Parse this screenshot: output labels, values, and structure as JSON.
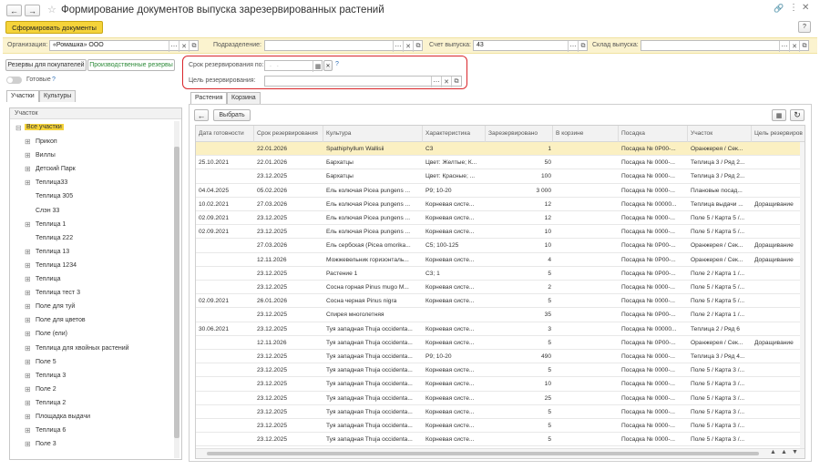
{
  "window": {
    "title": "Формирование документов выпуска зарезервированных растений",
    "help_label": "?"
  },
  "toolbar": {
    "generate_label": "Сформировать документы"
  },
  "filters": {
    "org_label": "Организация:",
    "org_value": "«Ромашка» ООО",
    "dept_label": "Подразделение:",
    "dept_value": "",
    "account_label": "Счет выпуска:",
    "account_value": "43",
    "warehouse_label": "Склад выпуска:",
    "warehouse_value": ""
  },
  "left": {
    "tab_buyers": "Резервы для покупателей",
    "tab_production": "Производственные резервы",
    "ready_label": "Готовые",
    "ready_help": "?",
    "subtab_sections": "Участки",
    "subtab_crops": "Культуры",
    "tree_header": "Участок",
    "tree_root": "Все участки",
    "tree_items": [
      {
        "label": "Прикоп",
        "expandable": true
      },
      {
        "label": "Виллы",
        "expandable": true
      },
      {
        "label": "Детский Парк",
        "expandable": true
      },
      {
        "label": "Теплица33",
        "expandable": true
      },
      {
        "label": "Теплица 305",
        "expandable": false
      },
      {
        "label": "Слэн 33",
        "expandable": false
      },
      {
        "label": "Теплица 1",
        "expandable": true
      },
      {
        "label": "Теплица 222",
        "expandable": false
      },
      {
        "label": "Теплица 13",
        "expandable": true
      },
      {
        "label": "Теплица 1234",
        "expandable": true
      },
      {
        "label": "Теплица",
        "expandable": true
      },
      {
        "label": "Теплица  тест 3",
        "expandable": true
      },
      {
        "label": "Поле для туй",
        "expandable": true
      },
      {
        "label": "Поле для цветов",
        "expandable": true
      },
      {
        "label": "Поле (ели)",
        "expandable": true
      },
      {
        "label": "Теплица для хвойных растений",
        "expandable": true
      },
      {
        "label": "Поле 5",
        "expandable": true
      },
      {
        "label": "Теплица 3",
        "expandable": true
      },
      {
        "label": "Поле 2",
        "expandable": true
      },
      {
        "label": "Теплица 2",
        "expandable": true
      },
      {
        "label": "Площадка выдачи",
        "expandable": true
      },
      {
        "label": "Теплица 6",
        "expandable": true
      },
      {
        "label": "Поле 3",
        "expandable": true
      }
    ]
  },
  "reserve_box": {
    "date_label": "Срок резервирования по:",
    "date_placeholder": ". .",
    "date_help": "?",
    "purpose_label": "Цель резервирования:",
    "purpose_value": ""
  },
  "main": {
    "tab_plants": "Растения",
    "tab_cart": "Корзина",
    "select_label": "Выбрать",
    "columns": [
      "Дата готовности",
      "Срок резервирования",
      "Культура",
      "Характеристика",
      "Зарезервировано",
      "В корзине",
      "Посадка",
      "Участок",
      "Цель резервиров"
    ],
    "rows": [
      [
        "",
        "22.01.2026",
        "Spathiphyllum Wallisii",
        "С3",
        "1",
        "",
        "Посадка № 0Р00-...",
        "Оранжерея / Сек...",
        ""
      ],
      [
        "25.10.2021",
        "22.01.2026",
        "Бархатцы",
        "Цвет: Желтые; К...",
        "50",
        "",
        "Посадка № 0000-...",
        "Теплица 3 / Ряд 2...",
        ""
      ],
      [
        "",
        "23.12.2025",
        "Бархатцы",
        "Цвет: Красные; ...",
        "100",
        "",
        "Посадка № 0000-...",
        "Теплица 3 / Ряд 2...",
        ""
      ],
      [
        "04.04.2025",
        "05.02.2026",
        "Ель колючая Picea pungens ...",
        "Р9; 10-20",
        "3 000",
        "",
        "Посадка № 0000-...",
        "Плановые посад...",
        ""
      ],
      [
        "10.02.2021",
        "27.03.2026",
        "Ель колючая Picea pungens ...",
        "Корневая систе...",
        "12",
        "",
        "Посадка № 00000...",
        "Теплица выдачи ...",
        "Доращивание"
      ],
      [
        "02.09.2021",
        "23.12.2025",
        "Ель колючая Picea pungens ...",
        "Корневая систе...",
        "12",
        "",
        "Посадка № 0000-...",
        "Поле 5 / Карта 5 /...",
        ""
      ],
      [
        "02.09.2021",
        "23.12.2025",
        "Ель колючая Picea pungens ...",
        "Корневая систе...",
        "10",
        "",
        "Посадка № 0000-...",
        "Поле 5 / Карта 5 /...",
        ""
      ],
      [
        "",
        "27.03.2026",
        "Ель сербская (Picea omorika...",
        "С5; 100-125",
        "10",
        "",
        "Посадка № 0Р00-...",
        "Оранжерея / Сек...",
        "Доращивание"
      ],
      [
        "",
        "12.11.2026",
        "Можжевельник горизонталь...",
        "Корневая систе...",
        "4",
        "",
        "Посадка № 0Р00-...",
        "Оранжерея / Сек...",
        "Доращивание"
      ],
      [
        "",
        "23.12.2025",
        "Растение 1",
        "С3; 1",
        "5",
        "",
        "Посадка № 0Р00-...",
        "Поле 2 / Карта 1 /...",
        ""
      ],
      [
        "",
        "23.12.2025",
        "Сосна горная Pinus mugo M...",
        "Корневая систе...",
        "2",
        "",
        "Посадка № 0000-...",
        "Поле 5 / Карта 5 /...",
        ""
      ],
      [
        "02.09.2021",
        "26.01.2026",
        "Сосна черная Pinus nigra",
        "Корневая систе...",
        "5",
        "",
        "Посадка № 0000-...",
        "Поле 5 / Карта 5 /...",
        ""
      ],
      [
        "",
        "23.12.2025",
        "Спирея многолетняя",
        "",
        "35",
        "",
        "Посадка № 0Р00-...",
        "Поле 2 / Карта 1 /...",
        ""
      ],
      [
        "30.06.2021",
        "23.12.2025",
        "Туя западная Thuja occidenta...",
        "Корневая систе...",
        "3",
        "",
        "Посадка № 00000...",
        "Теплица 2 / Ряд 6",
        ""
      ],
      [
        "",
        "12.11.2026",
        "Туя западная Thuja occidenta...",
        "Корневая систе...",
        "5",
        "",
        "Посадка № 0Р00-...",
        "Оранжерея / Сек...",
        "Доращивание"
      ],
      [
        "",
        "23.12.2025",
        "Туя западная Thuja occidenta...",
        "Р9; 10-20",
        "490",
        "",
        "Посадка № 0000-...",
        "Теплица 3 / Ряд 4...",
        ""
      ],
      [
        "",
        "23.12.2025",
        "Туя западная Thuja occidenta...",
        "Корневая систе...",
        "5",
        "",
        "Посадка № 0000-...",
        "Поле 5 / Карта 3 /...",
        ""
      ],
      [
        "",
        "23.12.2025",
        "Туя западная Thuja occidenta...",
        "Корневая систе...",
        "10",
        "",
        "Посадка № 0000-...",
        "Поле 5 / Карта 3 /...",
        ""
      ],
      [
        "",
        "23.12.2025",
        "Туя западная Thuja occidenta...",
        "Корневая систе...",
        "25",
        "",
        "Посадка № 0000-...",
        "Поле 5 / Карта 3 /...",
        ""
      ],
      [
        "",
        "23.12.2025",
        "Туя западная Thuja occidenta...",
        "Корневая систе...",
        "5",
        "",
        "Посадка № 0000-...",
        "Поле 5 / Карта 3 /...",
        ""
      ],
      [
        "",
        "23.12.2025",
        "Туя западная Thuja occidenta...",
        "Корневая систе...",
        "5",
        "",
        "Посадка № 0000-...",
        "Поле 5 / Карта 3 /...",
        ""
      ],
      [
        "",
        "23.12.2025",
        "Туя западная Thuja occidenta...",
        "Корневая систе...",
        "5",
        "",
        "Посадка № 0000-...",
        "Поле 5 / Карта 3 /...",
        ""
      ]
    ]
  },
  "colors": {
    "accent_yellow": "#f5d33a",
    "selected_row": "#fbf0c2",
    "highlight_box": "#d9262b",
    "filter_bar": "#fbf3cf",
    "green_text": "#2e8b3a"
  },
  "icons": [
    "back-icon",
    "forward-icon",
    "star-icon",
    "link-icon",
    "more-icon",
    "close-icon",
    "calendar-icon",
    "refresh-icon",
    "table-settings-icon"
  ]
}
